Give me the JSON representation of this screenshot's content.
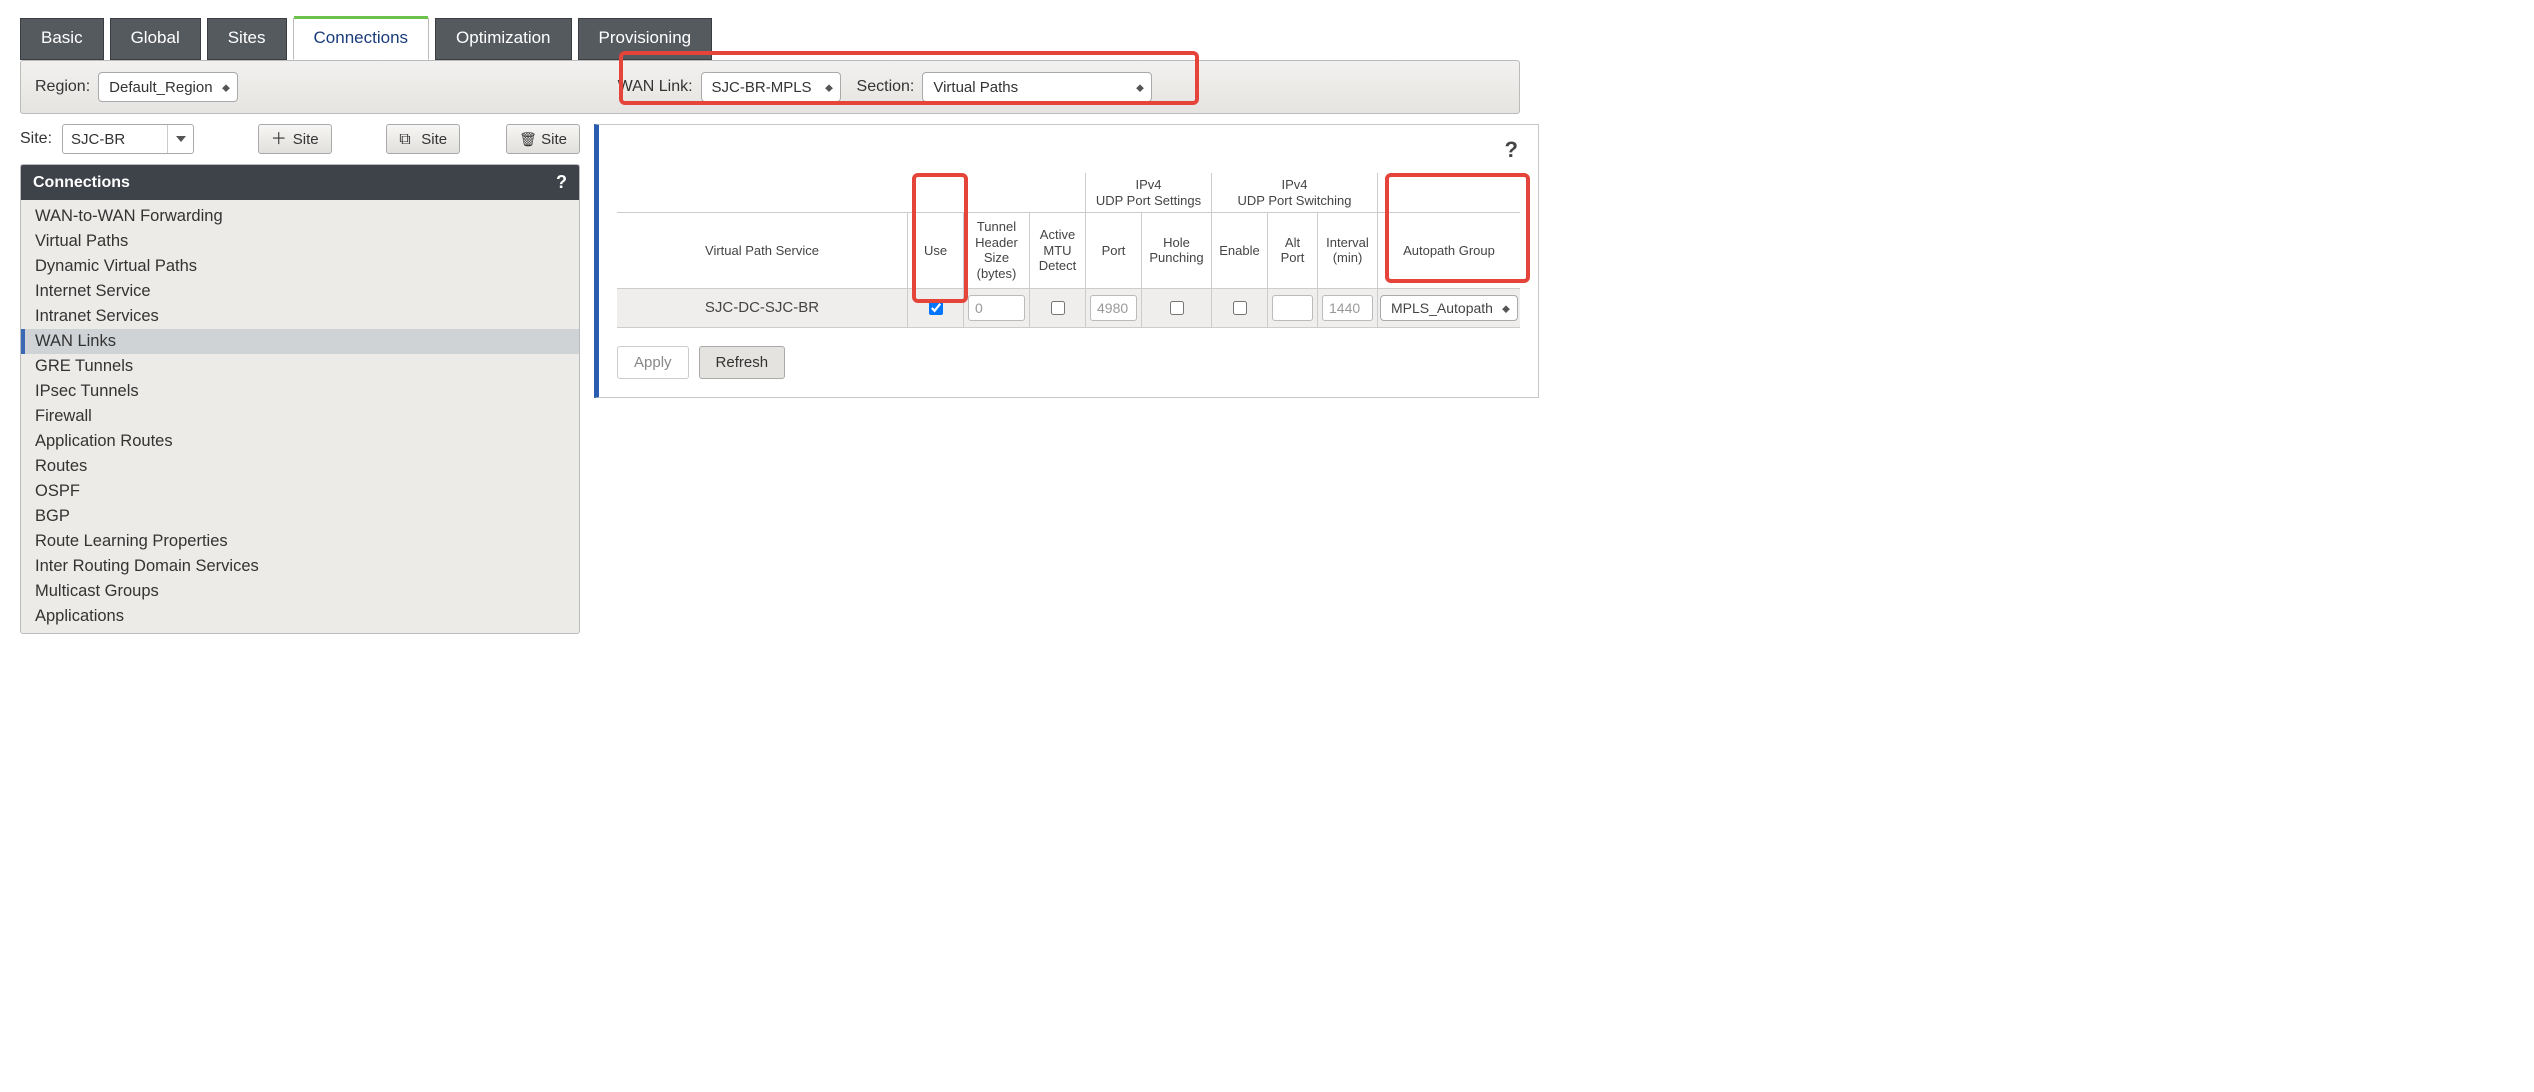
{
  "tabs": {
    "basic": "Basic",
    "global": "Global",
    "sites": "Sites",
    "connections": "Connections",
    "optimization": "Optimization",
    "provisioning": "Provisioning"
  },
  "toolbar": {
    "region_label": "Region:",
    "region_value": "Default_Region",
    "wan_link_label": "WAN Link:",
    "wan_link_value": "SJC-BR-MPLS",
    "section_label": "Section:",
    "section_value": "Virtual Paths"
  },
  "site_row": {
    "site_label": "Site:",
    "site_value": "SJC-BR",
    "add_site": "Site",
    "copy_site": "Site",
    "delete_site": "Site"
  },
  "nav": {
    "header": "Connections",
    "help": "?",
    "items": [
      "WAN-to-WAN Forwarding",
      "Virtual Paths",
      "Dynamic Virtual Paths",
      "Internet Service",
      "Intranet Services",
      "WAN Links",
      "GRE Tunnels",
      "IPsec Tunnels",
      "Firewall",
      "Application Routes",
      "Routes",
      "OSPF",
      "BGP",
      "Route Learning Properties",
      "Inter Routing Domain Services",
      "Multicast Groups",
      "Applications"
    ],
    "selected_index": 5
  },
  "grid": {
    "group_headers": {
      "ipv4_settings": "IPv4\nUDP Port Settings",
      "ipv4_switching": "IPv4\nUDP Port Switching"
    },
    "columns": {
      "vps": "Virtual Path Service",
      "use": "Use",
      "tunnel_header_size": "Tunnel\nHeader\nSize\n(bytes)",
      "active_mtu": "Active\nMTU\nDetect",
      "port": "Port",
      "hole_punching": "Hole\nPunching",
      "enable": "Enable",
      "alt_port": "Alt\nPort",
      "interval": "Interval\n(min)",
      "autopath": "Autopath Group"
    },
    "row": {
      "vps": "SJC-DC-SJC-BR",
      "use": true,
      "tunnel_header_size": "0",
      "active_mtu": false,
      "port": "4980",
      "hole_punching": false,
      "enable": false,
      "alt_port": "",
      "interval": "1440",
      "autopath": "MPLS_Autopath"
    }
  },
  "actions": {
    "apply": "Apply",
    "refresh": "Refresh"
  },
  "help_icon": "?"
}
